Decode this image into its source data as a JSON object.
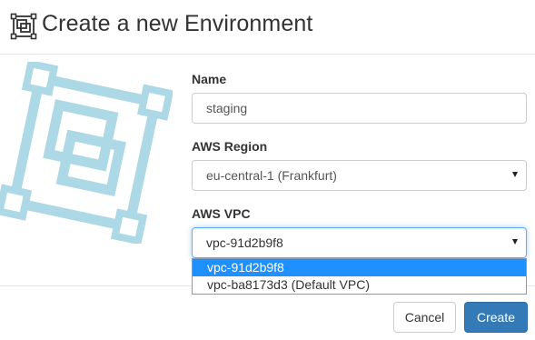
{
  "header": {
    "title": "Create a new Environment",
    "icon": "environment-icon"
  },
  "hero": {
    "icon": "environment-icon",
    "color": "#add8e6"
  },
  "form": {
    "name": {
      "label": "Name",
      "value": "staging"
    },
    "region": {
      "label": "AWS Region",
      "value": "eu-central-1 (Frankfurt)"
    },
    "vpc": {
      "label": "AWS VPC",
      "value": "vpc-91d2b9f8",
      "options": [
        "vpc-91d2b9f8",
        "vpc-ba8173d3 (Default VPC)"
      ]
    }
  },
  "footer": {
    "cancel_label": "Cancel",
    "create_label": "Create"
  },
  "colors": {
    "primary": "#337ab7",
    "focus": "#66afe9",
    "highlight": "#1e90ff"
  }
}
